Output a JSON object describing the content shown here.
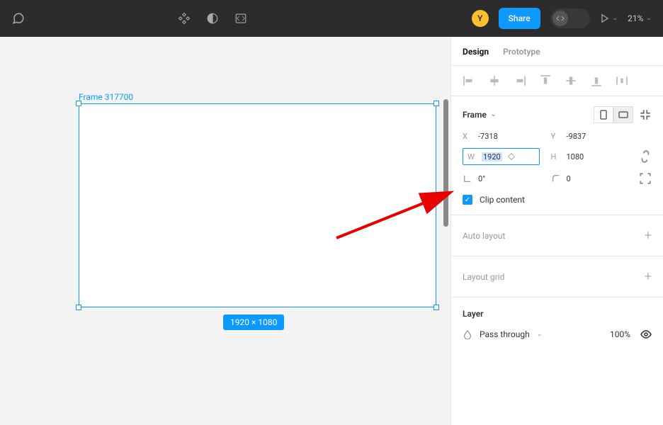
{
  "toolbar": {
    "avatar_letter": "Y",
    "share_label": "Share",
    "zoom": "21%"
  },
  "canvas": {
    "frame_label": "Frame 317700",
    "dims_badge": "1920 × 1080"
  },
  "panel": {
    "tab_design": "Design",
    "tab_prototype": "Prototype",
    "frame": {
      "title": "Frame",
      "x_label": "X",
      "x_value": "-7318",
      "y_label": "Y",
      "y_value": "-9837",
      "w_label": "W",
      "w_value": "1920",
      "h_label": "H",
      "h_value": "1080",
      "rotation_value": "0°",
      "radius_value": "0",
      "clip_label": "Clip content"
    },
    "auto_layout": "Auto layout",
    "layout_grid": "Layout grid",
    "layer": {
      "title": "Layer",
      "blend": "Pass through",
      "opacity": "100%"
    }
  }
}
